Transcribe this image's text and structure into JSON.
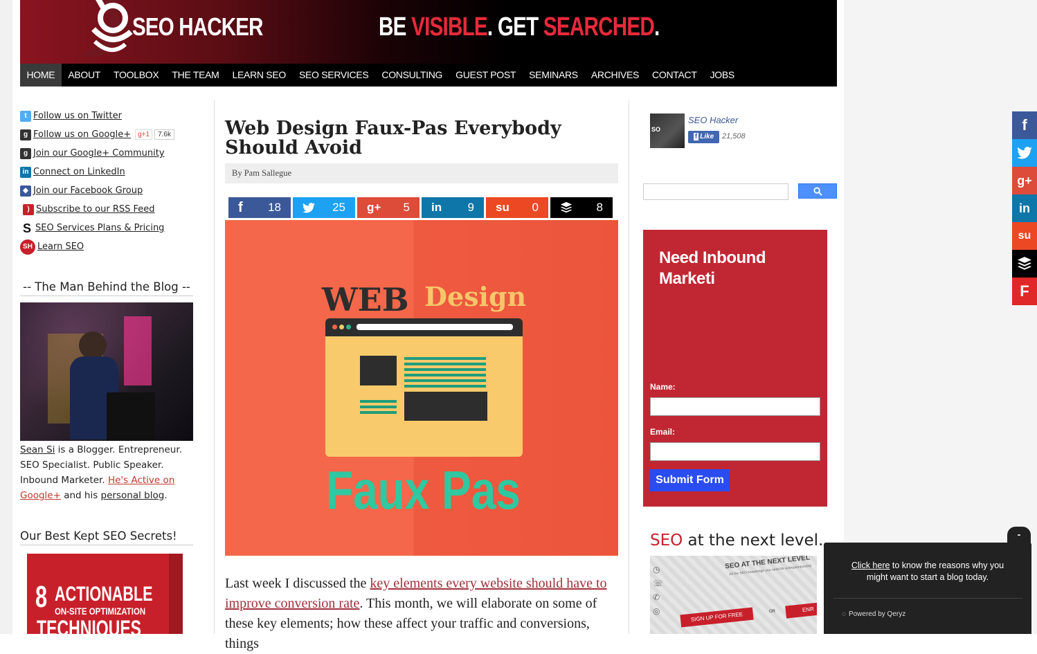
{
  "header": {
    "logo_text": "SEO HACKER",
    "tagline_parts": [
      "BE ",
      "VISIBLE",
      ". GET ",
      "SEARCHED",
      "."
    ],
    "nav": [
      "HOME",
      "ABOUT",
      "TOOLBOX",
      "THE TEAM",
      "LEARN SEO",
      "SEO SERVICES",
      "CONSULTING",
      "GUEST POST",
      "SEMINARS",
      "ARCHIVES",
      "CONTACT",
      "JOBS"
    ],
    "active_nav": "HOME"
  },
  "left_sidebar": {
    "social_links": [
      {
        "label": "Follow us on Twitter",
        "icon": "twitter-icon"
      },
      {
        "label": "Follow us on Google+",
        "icon": "google-plus-icon"
      },
      {
        "label": "Join our Google+ Community",
        "icon": "google-plus-community-icon"
      },
      {
        "label": "Connect on LinkedIn",
        "icon": "linkedin-icon"
      },
      {
        "label": "Join our Facebook Group",
        "icon": "facebook-group-icon"
      },
      {
        "label": "Subscribe to our RSS Feed",
        "icon": "rss-icon"
      },
      {
        "label": "SEO Services Plans & Pricing",
        "icon": "seo-services-icon"
      },
      {
        "label": "Learn SEO",
        "icon": "sh-logo-icon"
      }
    ],
    "gplus_button": "g+1",
    "gplus_count": "7.6k",
    "author_title": "-- The Man Behind the Blog --",
    "bio": {
      "name_link": "Sean Si",
      "text1": " is a Blogger. Entrepreneur. SEO Specialist. Public Speaker. Inbound Marketer. ",
      "active_link": "He's Active on Google+",
      "text2": " and his ",
      "blog_link": "personal blog",
      "text3": "."
    },
    "secrets_title": "Our Best Kept SEO Secrets!",
    "ebook": {
      "big": "8",
      "line1": "ACTIONABLE",
      "line2": "ON-SITE OPTIMIZATION",
      "line3": "TECHNIQUES"
    }
  },
  "article": {
    "title": "Web Design Faux-Pas Everybody Should Avoid",
    "byline": "By Pam Sallegue",
    "shares": [
      {
        "network": "facebook",
        "icon": "facebook-icon",
        "glyph": "f",
        "count": "18",
        "color": "#3b5998"
      },
      {
        "network": "twitter",
        "icon": "twitter-icon",
        "glyph": "🐦",
        "count": "25",
        "color": "#1da1f2"
      },
      {
        "network": "google-plus",
        "icon": "google-plus-icon",
        "glyph": "g+",
        "count": "5",
        "color": "#dd4b39"
      },
      {
        "network": "linkedin",
        "icon": "linkedin-icon",
        "glyph": "in",
        "count": "9",
        "color": "#0e76a8"
      },
      {
        "network": "stumbleupon",
        "icon": "stumbleupon-icon",
        "glyph": "su",
        "count": "0",
        "color": "#eb4823"
      },
      {
        "network": "buffer",
        "icon": "buffer-icon",
        "glyph": "≋",
        "count": "8",
        "color": "#000000"
      }
    ],
    "hero": {
      "web": "WEB",
      "design": "Design",
      "faux": "Faux Pas"
    },
    "body_parts": {
      "p1": "Last week I discussed the ",
      "link": "key elements every website should have to improve conversion rate",
      "p2": ". This month, we will elaborate on some of these key elements; how these affect your traffic and conversions, things"
    }
  },
  "right_sidebar": {
    "fb_page_name": "SEO Hacker",
    "fb_like": "Like",
    "fb_count": "21,508",
    "search_placeholder": "",
    "inbound_title": "Need Inbound Marketi",
    "name_label": "Name:",
    "email_label": "Email:",
    "submit": "Submit Form",
    "seo_next_red": "SEO",
    "seo_next_rest": " at the next level.",
    "ad_headline": "SEO AT THE NEXT LEVEL",
    "ad_sub": "All the SEO knowledge you need for entrepreneurship",
    "ad_signup": "SIGN UP FOR FREE",
    "ad_or": "OR",
    "ad_enroll": "ENR"
  },
  "floating_share": [
    {
      "icon": "facebook-icon",
      "glyph": "f",
      "color": "#3b5998"
    },
    {
      "icon": "twitter-icon",
      "glyph": "🐦",
      "color": "#1da1f2"
    },
    {
      "icon": "google-plus-icon",
      "glyph": "g+",
      "color": "#dd4b39"
    },
    {
      "icon": "linkedin-icon",
      "glyph": "in",
      "color": "#0e76a8"
    },
    {
      "icon": "stumbleupon-icon",
      "glyph": "su",
      "color": "#eb4823"
    },
    {
      "icon": "buffer-icon",
      "glyph": "≋",
      "color": "#000000"
    },
    {
      "icon": "flipboard-icon",
      "glyph": "F",
      "color": "#e12828"
    }
  ],
  "qeryz": {
    "minimize": "-",
    "link": "Click here",
    "text": " to know the reasons why you might want to start a blog today.",
    "powered": "Powered by Qeryz"
  }
}
